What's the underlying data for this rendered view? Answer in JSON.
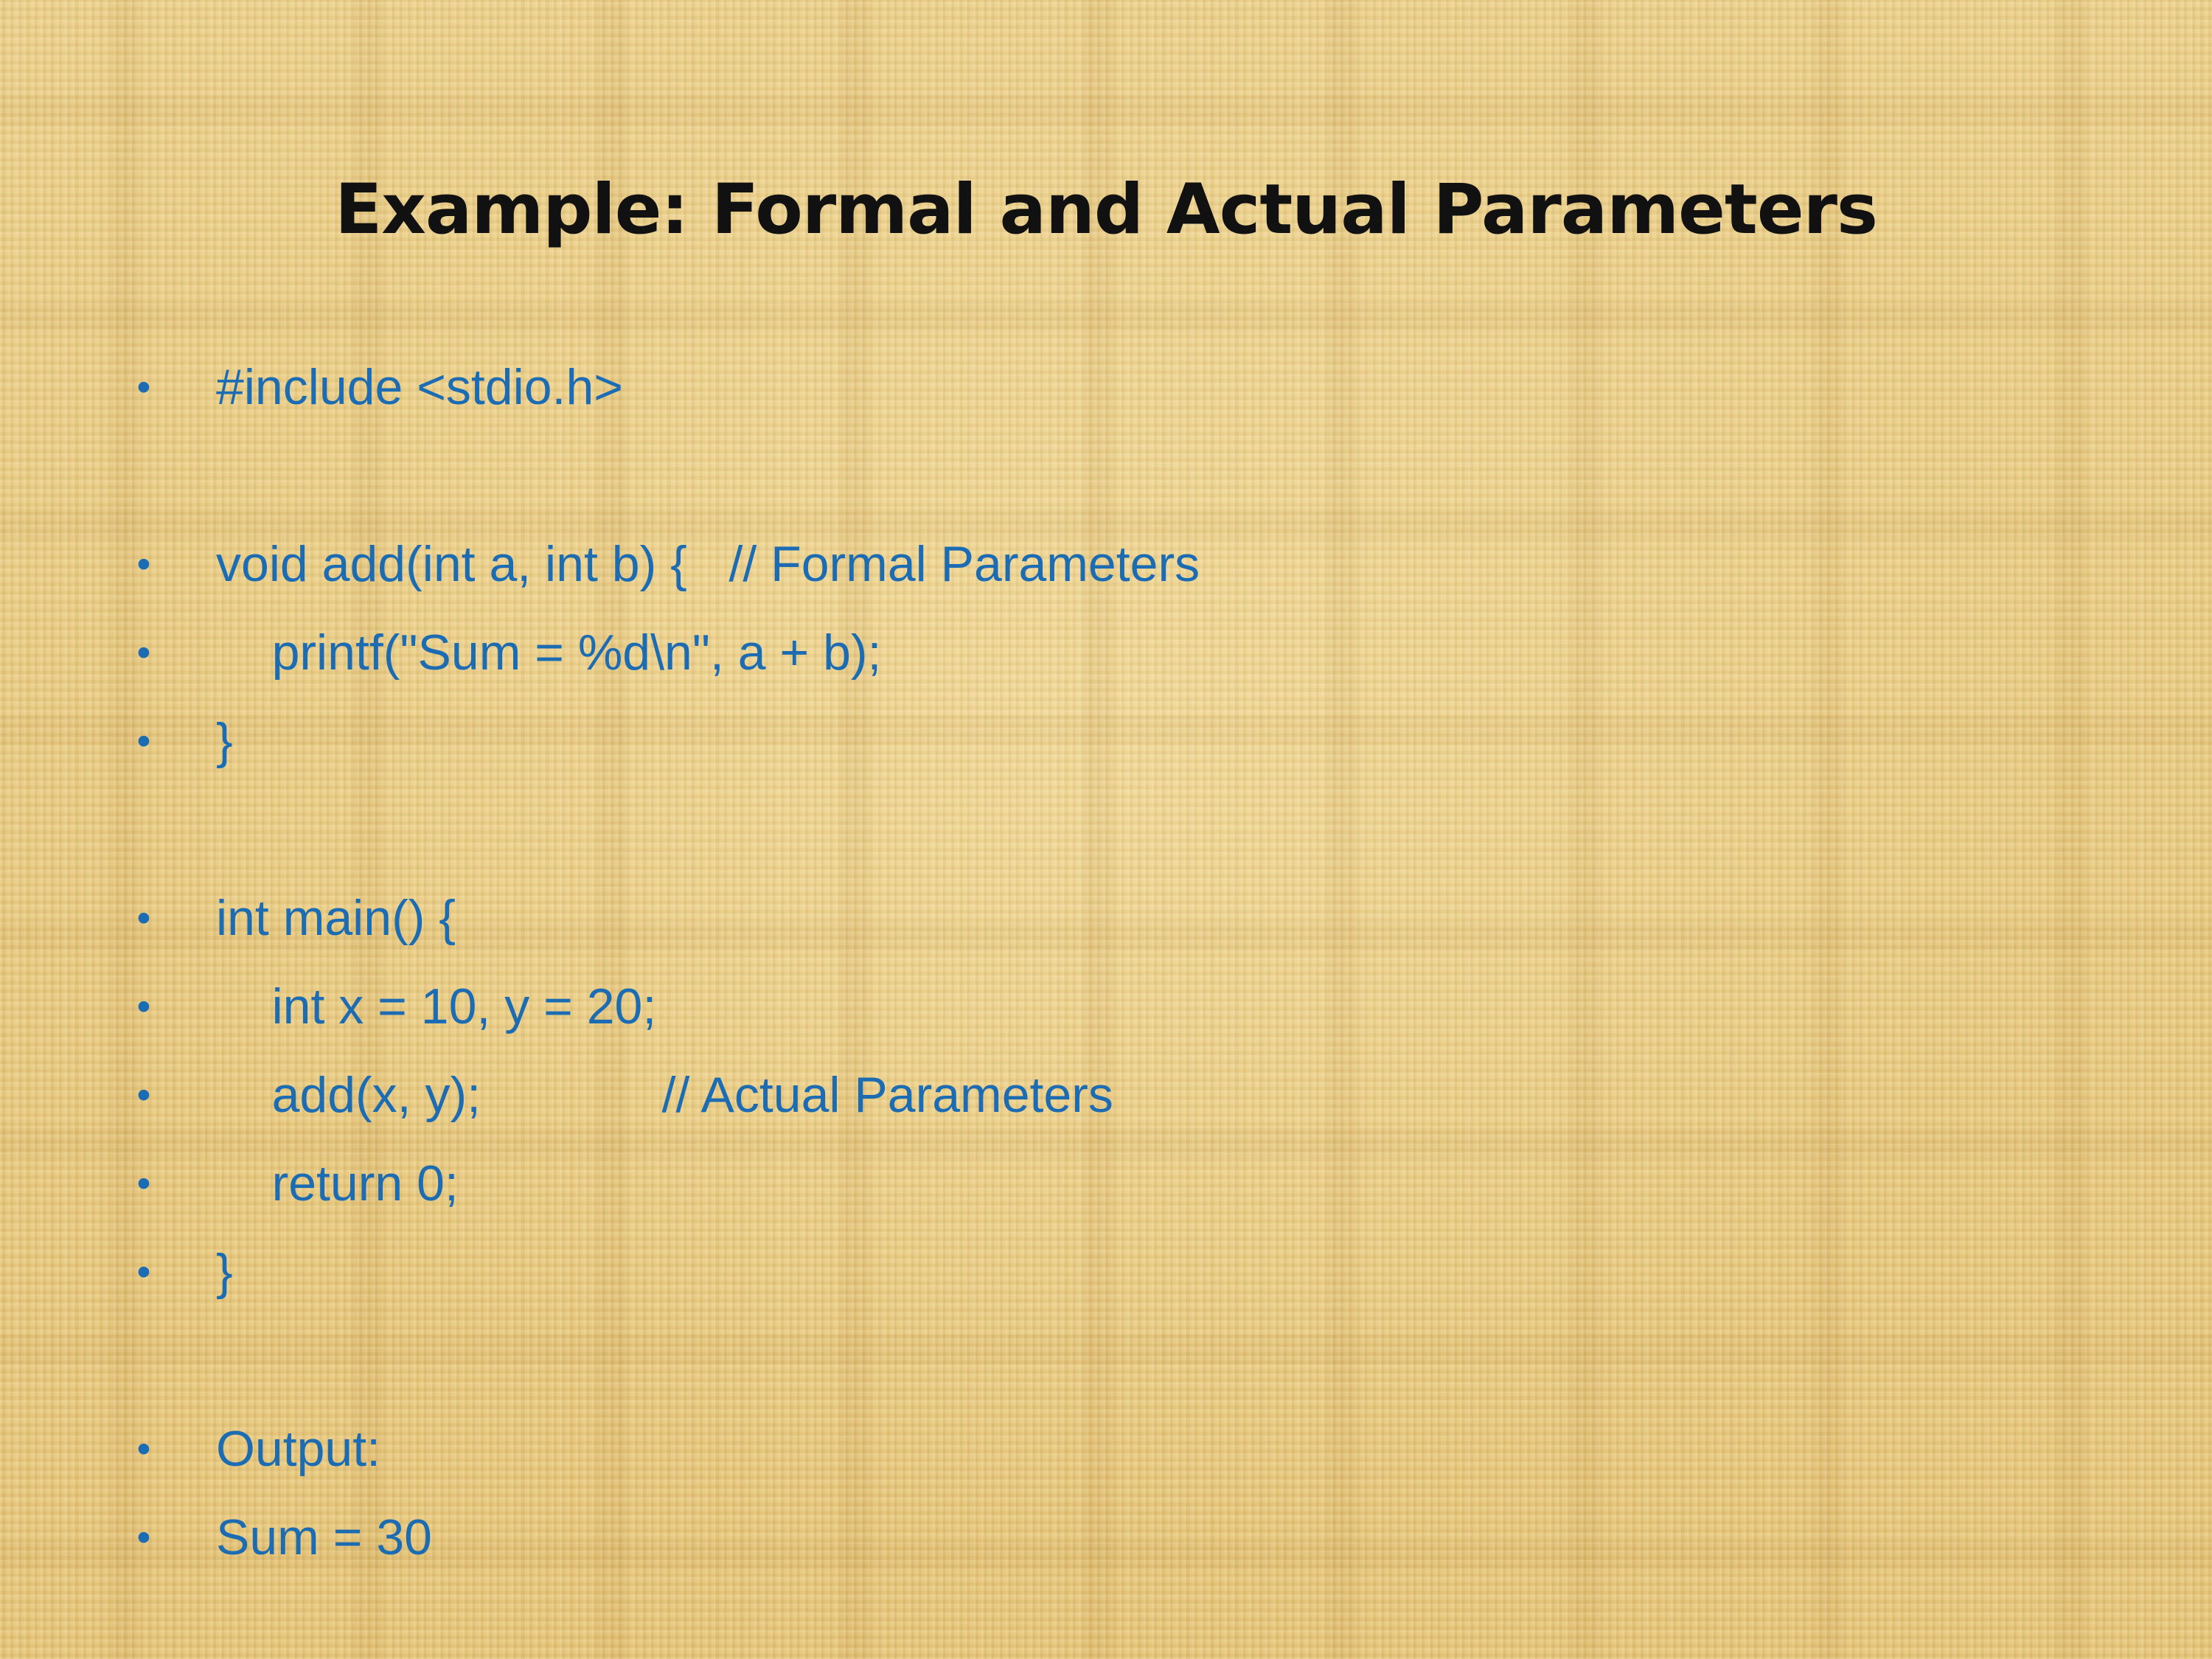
{
  "slide": {
    "title": "Example: Formal and Actual Parameters",
    "bullet_symbol": "•",
    "colors": {
      "title": "#111111",
      "code_text": "#1c6cb4",
      "background": "#e6c77e"
    },
    "lines": [
      "#include <stdio.h>",
      "",
      "void add(int a, int b) {   // Formal Parameters",
      "    printf(\"Sum = %d\\n\", a + b);",
      "}",
      "",
      "int main() {",
      "    int x = 10, y = 20;",
      "    add(x, y);             // Actual Parameters",
      "    return 0;",
      "}",
      "",
      "Output:",
      "Sum = 30"
    ]
  }
}
